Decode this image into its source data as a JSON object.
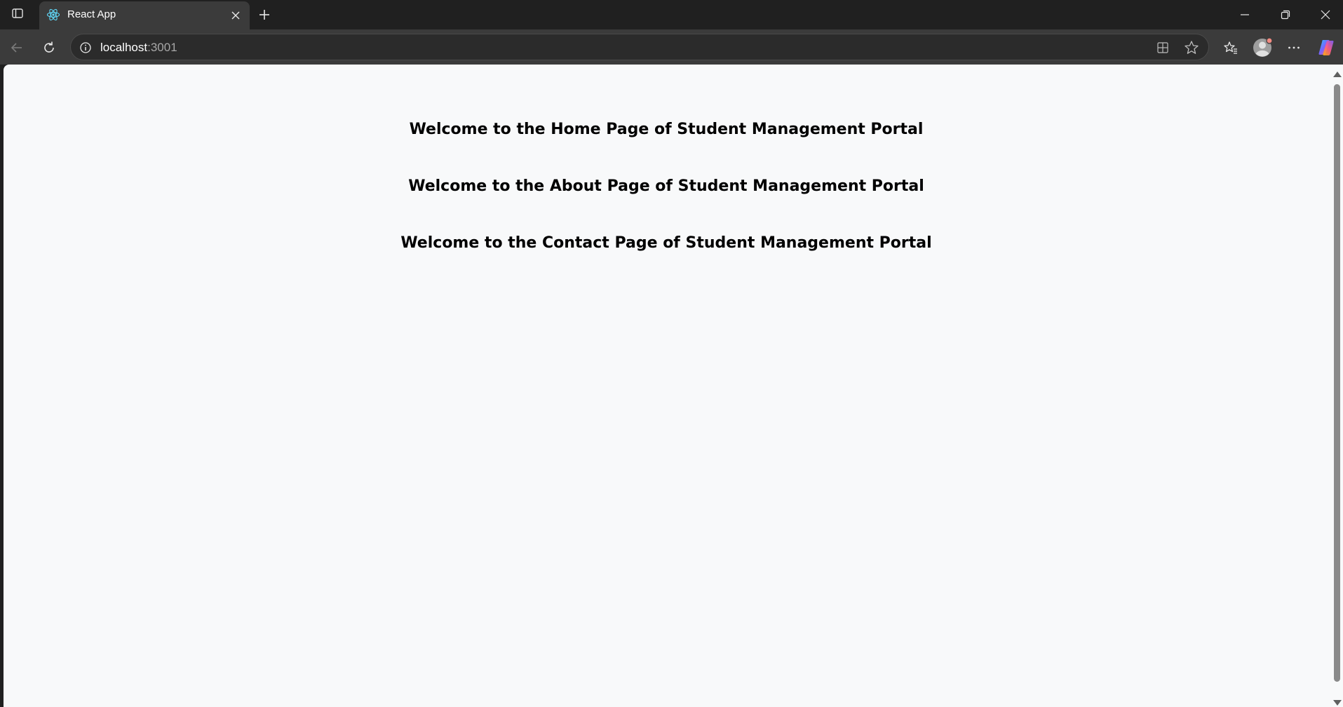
{
  "browser": {
    "tab": {
      "title": "React App",
      "favicon": "react-logo-icon"
    },
    "address": {
      "host": "localhost",
      "port": ":3001"
    },
    "icons": {
      "tab_actions": "tab-actions-icon",
      "close_tab": "close-icon",
      "new_tab": "plus-icon",
      "minimize": "minimize-icon",
      "restore": "restore-icon",
      "close_window": "close-icon",
      "back": "back-arrow-icon",
      "refresh": "refresh-icon",
      "site_info": "info-icon",
      "app_available": "app-icon",
      "favorite": "star-icon",
      "favorites": "favorites-icon",
      "profile": "profile-icon",
      "more": "more-icon",
      "copilot": "copilot-icon"
    },
    "colors": {
      "titlebar": "#202020",
      "toolbar": "#3b3b3b",
      "page_background": "#f8f9fa"
    }
  },
  "page": {
    "headings": [
      "Welcome to the Home Page of Student Management Portal",
      "Welcome to the About Page of Student Management Portal",
      "Welcome to the Contact Page of Student Management Portal"
    ]
  }
}
